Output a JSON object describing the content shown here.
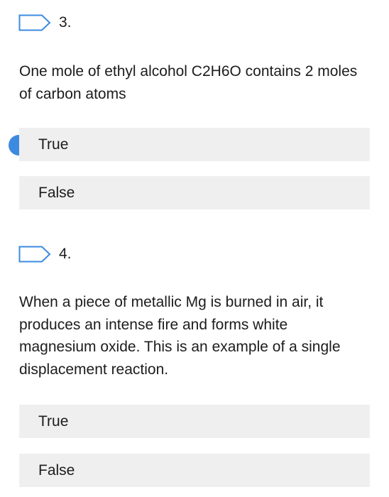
{
  "questions": [
    {
      "number": "3.",
      "text": "One mole of ethyl alcohol C2H6O contains 2 moles of carbon atoms",
      "options": [
        {
          "label": "True",
          "selected": true
        },
        {
          "label": "False",
          "selected": false
        }
      ]
    },
    {
      "number": "4.",
      "text": "When a piece of metallic Mg  is burned in air, it produces an intense fire and forms white magnesium oxide. This is an example of a single displacement reaction.",
      "options": [
        {
          "label": "True",
          "selected": false
        },
        {
          "label": "False",
          "selected": false
        }
      ]
    }
  ],
  "colors": {
    "accent": "#3d8be0",
    "option_background": "#efefef",
    "text": "#1c1c1e"
  }
}
